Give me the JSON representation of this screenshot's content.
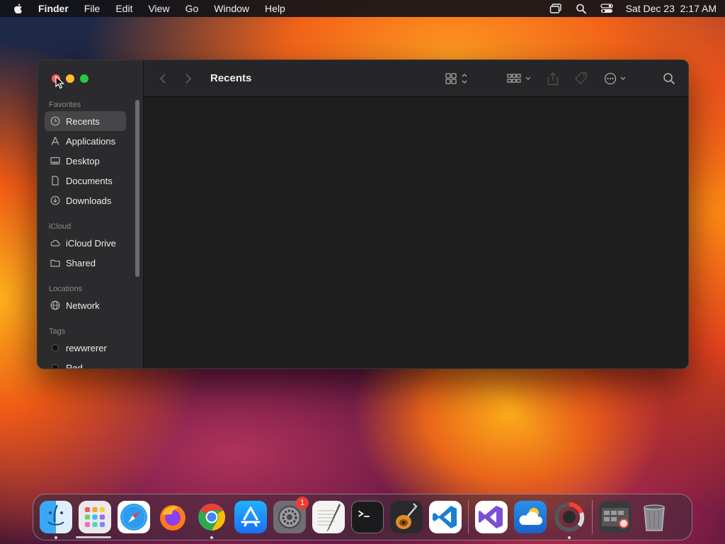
{
  "menubar": {
    "app_name": "Finder",
    "menus": [
      "File",
      "Edit",
      "View",
      "Go",
      "Window",
      "Help"
    ],
    "clock": "Sat Dec 23  2:17 AM",
    "status_icons": [
      "screen-mirroring-icon",
      "spotlight-icon",
      "control-center-icon"
    ]
  },
  "window": {
    "title": "Recents",
    "sidebar": {
      "sections": [
        {
          "label": "Favorites",
          "items": [
            {
              "label": "Recents",
              "icon": "clock-icon",
              "active": true
            },
            {
              "label": "Applications",
              "icon": "applications-icon"
            },
            {
              "label": "Desktop",
              "icon": "desktop-icon"
            },
            {
              "label": "Documents",
              "icon": "document-icon"
            },
            {
              "label": "Downloads",
              "icon": "download-icon"
            }
          ]
        },
        {
          "label": "iCloud",
          "items": [
            {
              "label": "iCloud Drive",
              "icon": "cloud-icon"
            },
            {
              "label": "Shared",
              "icon": "shared-folder-icon"
            }
          ]
        },
        {
          "label": "Locations",
          "items": [
            {
              "label": "Network",
              "icon": "globe-icon"
            }
          ]
        },
        {
          "label": "Tags",
          "items": [
            {
              "label": "rewwrerer",
              "tag_color": "#e8e8e8"
            },
            {
              "label": "Red",
              "tag_color": "#ff4b3e"
            }
          ]
        }
      ]
    },
    "toolbar_icons": [
      "back-icon",
      "forward-icon",
      "icon-view-icon",
      "group-by-icon",
      "share-icon",
      "tag-icon",
      "more-actions-icon",
      "search-icon"
    ]
  },
  "dock": {
    "apps": [
      {
        "icon": "finder-icon",
        "running": true
      },
      {
        "icon": "launchpad-icon"
      },
      {
        "icon": "safari-icon"
      },
      {
        "icon": "firefox-icon"
      },
      {
        "icon": "chrome-icon",
        "running": true
      },
      {
        "icon": "app-store-icon"
      },
      {
        "icon": "system-settings-icon",
        "badge": "1"
      },
      {
        "icon": "textedit-icon"
      },
      {
        "icon": "terminal-icon"
      },
      {
        "icon": "garageband-icon"
      },
      {
        "icon": "vscode-icon"
      },
      {
        "icon": "visual-studio-icon"
      },
      {
        "icon": "cloud-app-icon"
      },
      {
        "icon": "activity-monitor-icon",
        "running": true
      },
      {
        "icon": "screen-capture-icon"
      },
      {
        "icon": "trash-icon"
      }
    ]
  }
}
